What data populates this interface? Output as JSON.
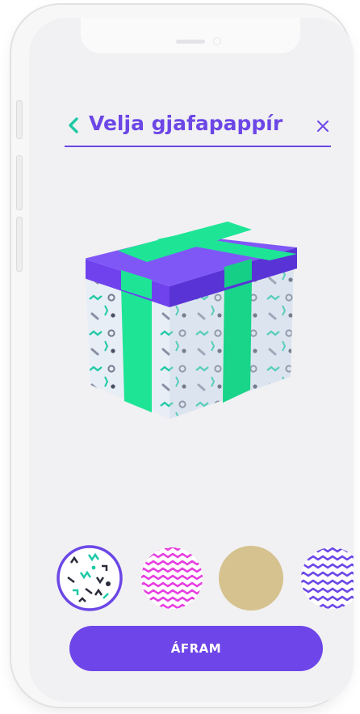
{
  "header": {
    "title": "Velja gjafapappír",
    "back_icon": "chevron-left-icon",
    "close_icon": "close-icon"
  },
  "gift": {
    "icon": "gift-box-3d",
    "colors": {
      "lid": "#6f42ee",
      "ribbon": "#1ee596",
      "box": "#e7eef6"
    }
  },
  "wrap_options": [
    {
      "name": "confetti",
      "selected": true
    },
    {
      "name": "pink-zigzag",
      "selected": false
    },
    {
      "name": "gold-solid",
      "selected": false
    },
    {
      "name": "purple-zigzag",
      "selected": false
    }
  ],
  "colors": {
    "accent": "#6c47e6",
    "teal": "#1fc9a6",
    "pink": "#e63fe0",
    "gold": "#d5c28e"
  },
  "cta": {
    "label": "ÁFRAM"
  }
}
